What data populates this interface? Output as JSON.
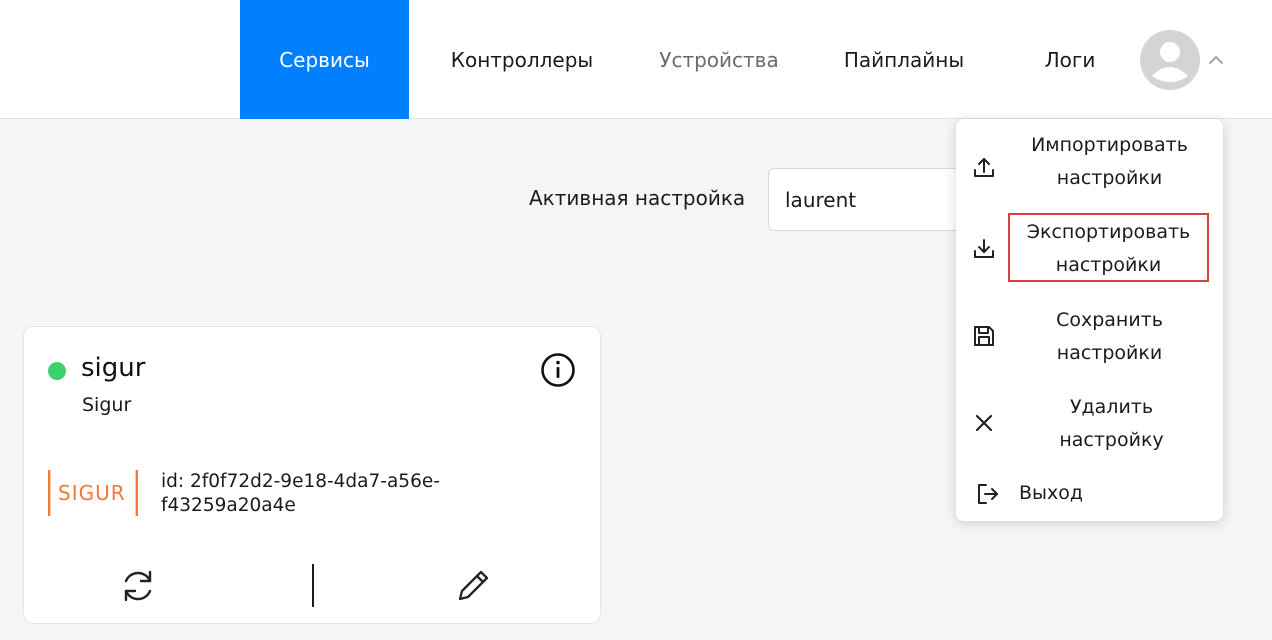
{
  "nav": {
    "tabs": [
      {
        "label": "Сервисы",
        "active": true
      },
      {
        "label": "Контроллеры"
      },
      {
        "label": "Устройства"
      },
      {
        "label": "Пайплайны"
      },
      {
        "label": "Логи"
      }
    ]
  },
  "settings": {
    "active_label": "Активная настройка",
    "active_value": "laurent"
  },
  "card": {
    "title": "sigur",
    "subtitle": "Sigur",
    "logo_text": "SIGUR",
    "id_text": "id: 2f0f72d2-9e18-4da7-a56e-f43259a20a4e",
    "status_color": "#3ed26e"
  },
  "menu": {
    "items": [
      {
        "label": "Импортировать\nнастройки",
        "icon": "upload-icon"
      },
      {
        "label": "Экспортировать\nнастройки",
        "icon": "download-icon"
      },
      {
        "label": "Сохранить\nнастройки",
        "icon": "save-icon"
      },
      {
        "label": "Удалить\nнастройку",
        "icon": "close-icon"
      },
      {
        "label": "Выход",
        "icon": "logout-icon"
      }
    ]
  },
  "colors": {
    "accent": "#0080ff",
    "logo": "#f07a3a",
    "highlight": "#d9403f"
  }
}
